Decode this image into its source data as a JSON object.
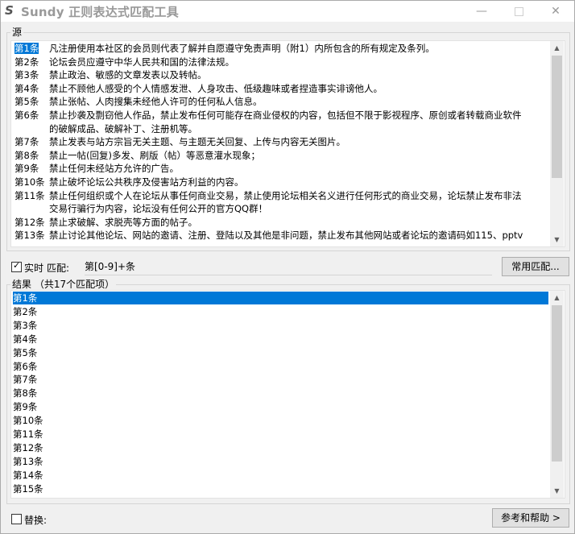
{
  "window": {
    "title": "Sundy 正则表达式匹配工具",
    "minimize": "—",
    "close": "✕"
  },
  "source": {
    "legend": "源",
    "lines": [
      {
        "num": "第1条",
        "text": "凡注册使用本社区的会员则代表了解并自愿遵守免责声明（附1）内所包含的所有规定及条列。"
      },
      {
        "num": "第2条",
        "text": "论坛会员应遵守中华人民共和国的法律法规。"
      },
      {
        "num": "第3条",
        "text": "禁止政治、敏感的文章发表以及转帖。"
      },
      {
        "num": "第4条",
        "text": "禁止不顾他人感受的个人情感发泄、人身攻击、低级趣味或者捏造事实诽谤他人。"
      },
      {
        "num": "第5条",
        "text": "禁止张帖、人肉搜集未经他人许可的任何私人信息。"
      },
      {
        "num": "第6条",
        "text": "禁止抄袭及剽窃他人作品，禁止发布任何可能存在商业侵权的内容，包括但不限于影视程序、原创或者转载商业软件"
      },
      {
        "num": "",
        "text": "的破解成品、破解补丁、注册机等。"
      },
      {
        "num": "第7条",
        "text": "禁止发表与站方宗旨无关主题、与主题无关回复、上传与内容无关图片。"
      },
      {
        "num": "第8条",
        "text": "禁止一帖(回复)多发、刷版（帖）等恶意灌水现象；"
      },
      {
        "num": "第9条",
        "text": "禁止任何未经站方允许的广告。"
      },
      {
        "num": "第10条",
        "text": "禁止破坏论坛公共秩序及侵害站方利益的内容。"
      },
      {
        "num": "第11条",
        "text": "禁止任何组织或个人在论坛从事任何商业交易，禁止使用论坛相关名义进行任何形式的商业交易，论坛禁止发布非法"
      },
      {
        "num": "",
        "text": "交易行骗行为内容，论坛没有任何公开的官方QQ群！"
      },
      {
        "num": "第12条",
        "text": "禁止求破解、求脱壳等方面的帖子。"
      },
      {
        "num": "第13条",
        "text": "禁止讨论其他论坛、网站的邀请、注册、登陆以及其他是非问题，禁止发布其他网站或者论坛的邀请码如115、pptv"
      }
    ]
  },
  "match": {
    "realtime_label": "实时",
    "realtime_checked": true,
    "label": "匹配:",
    "pattern": "第[0-9]+条",
    "common_button": "常用匹配..."
  },
  "results": {
    "legend": "结果 （共17个匹配项）",
    "items": [
      "第1条",
      "第2条",
      "第3条",
      "第4条",
      "第5条",
      "第6条",
      "第7条",
      "第8条",
      "第9条",
      "第10条",
      "第11条",
      "第12条",
      "第13条",
      "第14条",
      "第15条"
    ],
    "selected_index": 0
  },
  "replace": {
    "label": "替换:",
    "checked": false
  },
  "help_button": "参考和帮助 >"
}
